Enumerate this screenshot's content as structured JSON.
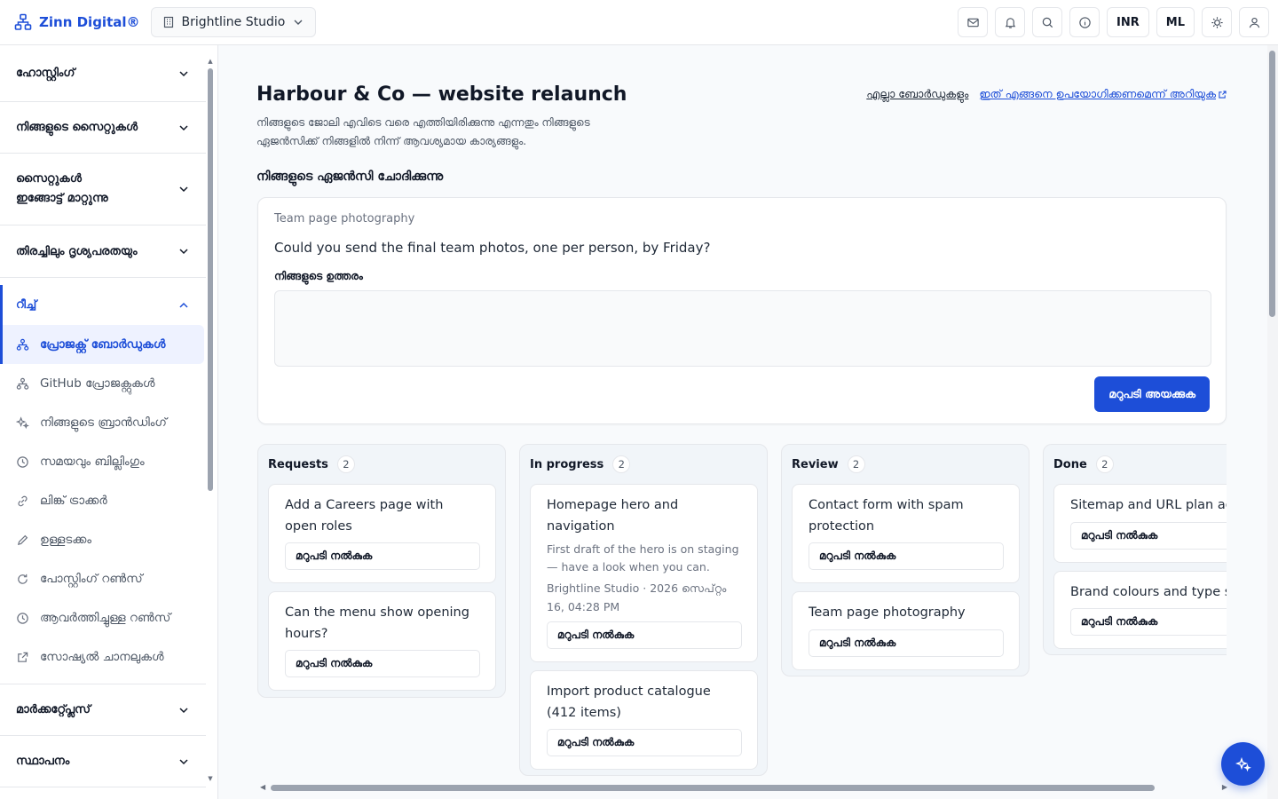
{
  "app": {
    "brand": "Zinn Digital®",
    "workspace": "Brightline Studio"
  },
  "topbar": {
    "currency": "INR",
    "language": "ML"
  },
  "sidebar": {
    "sections": [
      {
        "label": "ഹോസ്റ്റിംഗ്"
      },
      {
        "label": "നിങ്ങളുടെ സൈറ്റുകൾ"
      },
      {
        "label": "സൈറ്റുകൾ ഇങ്ങോട്ട് മാറ്റുന്നു"
      },
      {
        "label": "തിരച്ചിലും ദൃശ്യപരതയും"
      }
    ],
    "open_section": {
      "label": "റീച്ച്"
    },
    "items": [
      {
        "label": "പ്രോജക്റ്റ് ബോർഡുകൾ",
        "icon": "project-board-icon"
      },
      {
        "label": "GitHub പ്രോജക്റ്റുകൾ",
        "icon": "github-projects-icon"
      },
      {
        "label": "നിങ്ങളുടെ ബ്രാൻഡിംഗ്",
        "icon": "sparkle-icon"
      },
      {
        "label": "സമയവും ബില്ലിംഗും",
        "icon": "clock-icon"
      },
      {
        "label": "ലിങ്ക് ട്രാക്കർ",
        "icon": "link-icon"
      },
      {
        "label": "ഉള്ളടക്കം",
        "icon": "pencil-icon"
      },
      {
        "label": "പോസ്റ്റിംഗ് റൺസ്",
        "icon": "refresh-icon"
      },
      {
        "label": "ആവർത്തിച്ചുള്ള റൺസ്",
        "icon": "clock-icon"
      },
      {
        "label": "സോഷ്യൽ ചാനലുകൾ",
        "icon": "external-link-icon"
      }
    ],
    "bottom_sections": [
      {
        "label": "മാർക്കറ്റ്പ്ലേസ്"
      },
      {
        "label": "സ്ഥാപനം"
      }
    ]
  },
  "main": {
    "title": "Harbour & Co — website relaunch",
    "description": "നിങ്ങളുടെ ജോലി എവിടെ വരെ എത്തിയിരിക്കുന്നു എന്നതും നിങ്ങളുടെ ഏജൻസിക്ക് നിങ്ങളിൽ നിന്ന് ആവശ്യമായ കാര്യങ്ങളും.",
    "link_all_boards": "എല്ലാ ബോർഡുകളും",
    "link_how_to": "ഇത് എങ്ങനെ ഉപയോഗിക്കണമെന്ന് അറിയുക",
    "section_heading": "നിങ്ങളുടെ ഏജൻസി ചോദിക്കുന്നു",
    "ask": {
      "tag": "Team page photography",
      "question": "Could you send the final team photos, one per person, by Friday?",
      "answer_label": "നിങ്ങളുടെ ഉത്തരം",
      "answer_value": "",
      "send_label": "മറുപടി അയക്കുക"
    }
  },
  "board": {
    "reply_label": "മറുപടി നൽകുക",
    "columns": [
      {
        "name": "Requests",
        "count": "2",
        "cards": [
          {
            "title": "Add a Careers page with open roles"
          },
          {
            "title": "Can the menu show opening hours?"
          }
        ]
      },
      {
        "name": "In progress",
        "count": "2",
        "cards": [
          {
            "title": "Homepage hero and navigation",
            "note": "First draft of the hero is on staging — have a look when you can.",
            "meta": "Brightline Studio · 2026 സെപ്റ്റം 16, 04:28 PM"
          },
          {
            "title": "Import product catalogue (412 items)"
          }
        ]
      },
      {
        "name": "Review",
        "count": "2",
        "cards": [
          {
            "title": "Contact form with spam protection"
          },
          {
            "title": "Team page photography"
          }
        ]
      },
      {
        "name": "Done",
        "count": "2",
        "cards": [
          {
            "title": "Sitemap and URL plan ag"
          },
          {
            "title": "Brand colours and type s"
          }
        ]
      }
    ]
  },
  "colors": {
    "accent": "#1d4ed8",
    "border": "#e5e7eb",
    "column_bg": "#f1f5f9"
  }
}
